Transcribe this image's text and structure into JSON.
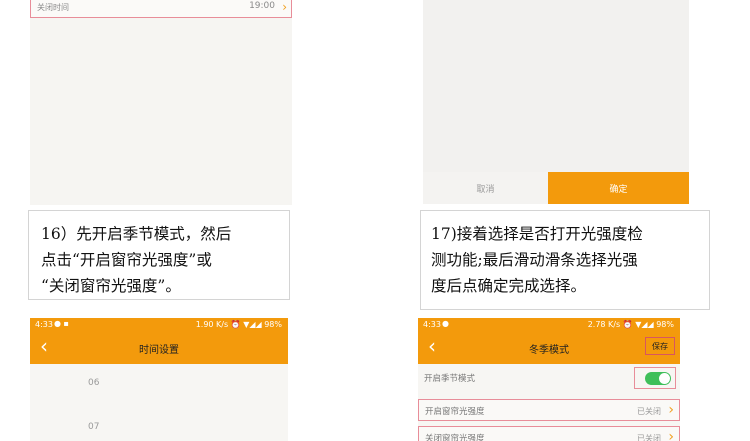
{
  "top_left": {
    "row_label": "关闭时间",
    "row_value": "19:00",
    "chevron": "chevron-right-icon"
  },
  "top_right": {
    "cancel_label": "取消",
    "confirm_label": "确定"
  },
  "notes": {
    "left": [
      "16）先开启季节模式，然后",
      "点击“开启窗帘光强度”或",
      "“关闭窗帘光强度”。"
    ],
    "right": [
      "17)接着选择是否打开光强度检",
      "测功能;最后滑动滑条选择光强",
      "度后点确定完成选择。"
    ]
  },
  "bottom_left": {
    "status_time": "4:33",
    "status_right": "1.90 K/s ⏰ ▼◢◢ 98%",
    "title": "时间设置",
    "hours": [
      "06",
      "07"
    ]
  },
  "bottom_right": {
    "status_time": "4:33",
    "status_right": "2.78 K/s ⏰ ▼◢◢ 98%",
    "title": "冬季模式",
    "save_label": "保存",
    "rows": [
      {
        "label": "开启季节模式",
        "toggle_on": true
      },
      {
        "label": "开启窗帘光强度",
        "value": "已关闭"
      },
      {
        "label": "关闭窗帘光强度",
        "value": "已关闭"
      }
    ]
  },
  "colors": {
    "accent": "#f39a0c",
    "toggle_on": "#3fbf5a",
    "highlight_border": "#e88d99"
  }
}
